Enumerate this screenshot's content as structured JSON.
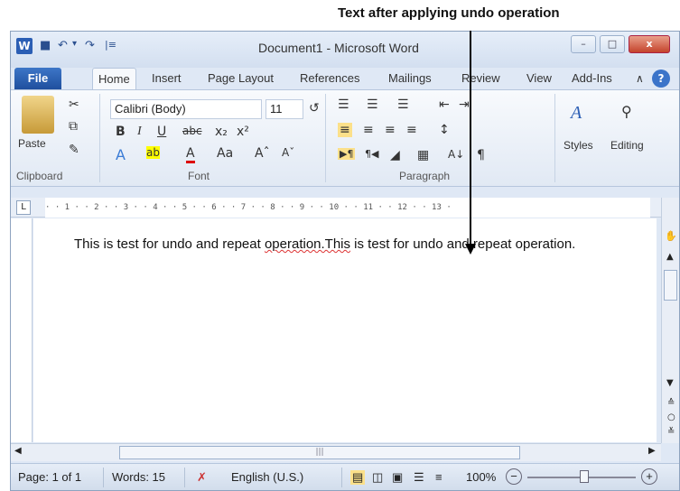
{
  "annotation": "Text after applying undo operation",
  "window": {
    "title": "Document1 - Microsoft Word",
    "minimize": "–",
    "restore": "□",
    "close": "x"
  },
  "qat": {
    "app_icon": "W",
    "save": "■",
    "undo": "↶",
    "undo_dd": "▾",
    "redo": "↷",
    "customize": "|≡"
  },
  "tabs": [
    "File",
    "Home",
    "Insert",
    "Page Layout",
    "References",
    "Mailings",
    "Review",
    "View",
    "Add-Ins"
  ],
  "ribbon": {
    "paste_label": "Paste",
    "font_name": "Calibri (Body)",
    "font_size": "11",
    "styles_label": "Styles",
    "editing_label": "Editing",
    "groups": {
      "clipboard": "Clipboard",
      "font": "Font",
      "paragraph": "Paragraph"
    }
  },
  "ruler": "· · 1 · · 2 · · 3 · · 4 · · 5 · · 6 · · 7 · · 8 · · 9 · · 10 · · 11 · · 12 · · 13 ·",
  "document": {
    "part1": "This is test for undo and repeat ",
    "part2": "operation.This",
    "part3": " is test for undo and repeat operation."
  },
  "status": {
    "page": "Page: 1 of 1",
    "words": "Words: 15",
    "language": "English (U.S.)",
    "zoom": "100%"
  },
  "colors": {
    "accent": "#2b5eb4",
    "close": "#c4432b"
  }
}
